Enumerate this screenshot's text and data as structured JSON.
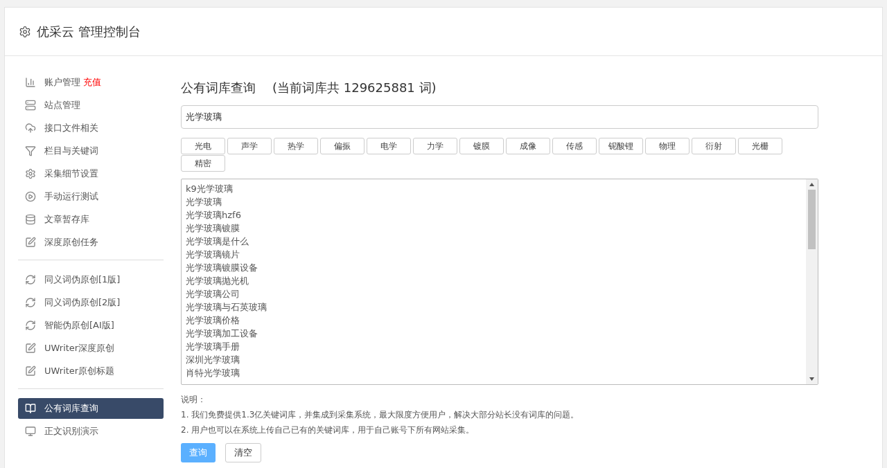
{
  "header": {
    "title": "优采云 管理控制台"
  },
  "sidebar": {
    "groups": [
      {
        "items": [
          {
            "kind": "chart",
            "label": "账户管理",
            "badge": "充值",
            "selected": false
          },
          {
            "kind": "server",
            "label": "站点管理",
            "selected": false
          },
          {
            "kind": "cloud",
            "label": "接口文件相关",
            "selected": false
          },
          {
            "kind": "filter",
            "label": "栏目与关键词",
            "selected": false
          },
          {
            "kind": "gears",
            "label": "采集细节设置",
            "selected": false
          },
          {
            "kind": "play",
            "label": "手动运行测试",
            "selected": false
          },
          {
            "kind": "database",
            "label": "文章暂存库",
            "selected": false
          },
          {
            "kind": "edit",
            "label": "深度原创任务",
            "selected": false
          }
        ]
      },
      {
        "items": [
          {
            "kind": "refresh",
            "label": "同义词伪原创[1版]",
            "selected": false
          },
          {
            "kind": "refresh",
            "label": "同义词伪原创[2版]",
            "selected": false
          },
          {
            "kind": "refresh",
            "label": "智能伪原创[AI版]",
            "selected": false
          },
          {
            "kind": "edit",
            "label": "UWriter深度原创",
            "selected": false
          },
          {
            "kind": "edit",
            "label": "UWriter原创标题",
            "selected": false
          }
        ]
      },
      {
        "items": [
          {
            "kind": "book",
            "label": "公有词库查询",
            "selected": true
          },
          {
            "kind": "monitor",
            "label": "正文识别演示",
            "selected": false
          }
        ]
      }
    ]
  },
  "main": {
    "title": "公有词库查询",
    "subtitle": "(当前词库共 129625881 词)",
    "search": {
      "value": "光学玻璃"
    },
    "tags": [
      "光电",
      "声学",
      "热学",
      "偏振",
      "电学",
      "力学",
      "镀膜",
      "成像",
      "传感",
      "铌酸锂",
      "物理",
      "衍射",
      "光栅",
      "精密"
    ],
    "results": [
      "k9光学玻璃",
      "光学玻璃",
      "光学玻璃hzf6",
      "光学玻璃镀膜",
      "光学玻璃是什么",
      "光学玻璃镜片",
      "光学玻璃镀膜设备",
      "光学玻璃抛光机",
      "光学玻璃公司",
      "光学玻璃与石英玻璃",
      "光学玻璃价格",
      "光学玻璃加工设备",
      "光学玻璃手册",
      "深圳光学玻璃",
      "肖特光学玻璃"
    ],
    "notes_title": "说明：",
    "notes": [
      "1. 我们免费提供1.3亿关键词库，并集成到采集系统，最大限度方便用户，解决大部分站长没有词库的问题。",
      "2. 用户也可以在系统上传自己已有的关键词库，用于自己账号下所有网站采集。"
    ],
    "buttons": [
      {
        "kind": "primary",
        "label": "查询"
      },
      {
        "kind": "default",
        "label": "清空"
      }
    ]
  }
}
